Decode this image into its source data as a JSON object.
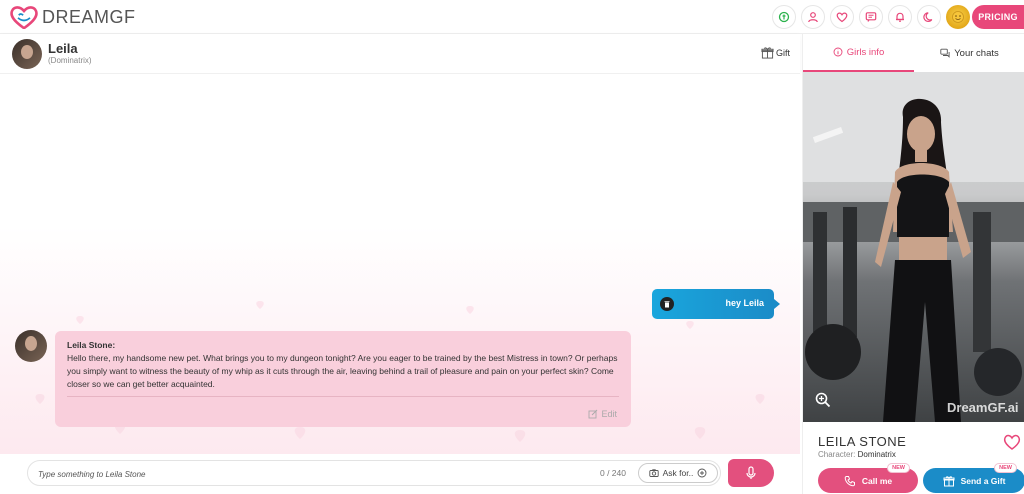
{
  "brand": {
    "name": "DREAMGF",
    "accent": "#e8477a",
    "secondary": "#1b8cc8"
  },
  "header": {
    "icons": [
      "coins-icon",
      "user-icon",
      "heart-icon",
      "chat-icon",
      "bell-icon",
      "moon-icon",
      "avatar-emoji"
    ],
    "pricing_label": "PRICING"
  },
  "chat": {
    "name": "Leila",
    "subtitle": "(Dominatrix)",
    "gift_label": "Gift",
    "messages": [
      {
        "from": "user",
        "text": "hey Leila"
      },
      {
        "from": "girl",
        "sender": "Leila Stone:",
        "text": "Hello there, my handsome new pet. What brings you to my dungeon tonight? Are you eager to be trained by the best Mistress in town? Or perhaps you simply want to witness the beauty of my whip as it cuts through the air, leaving behind a trail of pleasure and pain on your perfect skin? Come closer so we can get better acquainted.",
        "edit_label": "Edit"
      }
    ],
    "input": {
      "placeholder": "Type something to Leila Stone",
      "value": "",
      "char_count": "0 / 240"
    },
    "ask_label": "Ask for.."
  },
  "panel": {
    "tabs": [
      {
        "label": "Girls info",
        "active": true
      },
      {
        "label": "Your chats",
        "active": false
      }
    ],
    "watermark": "DreamGF.ai",
    "profile_name": "LEILA STONE",
    "character_label": "Character:",
    "character_value": "Dominatrix",
    "call_label": "Call me",
    "gift_label": "Send a Gift",
    "new_badge": "NEW"
  }
}
